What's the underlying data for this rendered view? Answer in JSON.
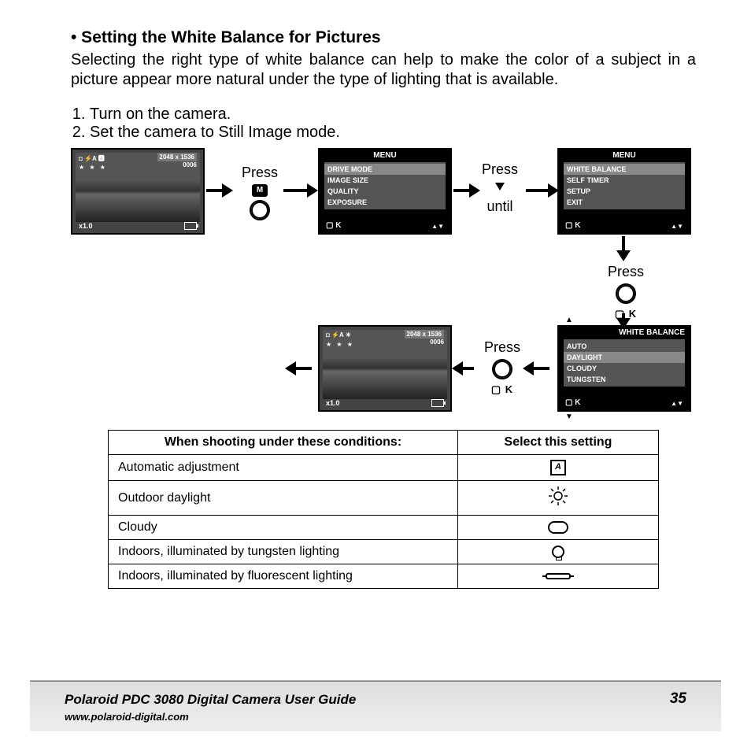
{
  "section_title": "• Setting the White Balance for Pictures",
  "intro": "Selecting the right type of white balance can help to make the color of a subject in a picture appear more natural under the type of lighting that is available.",
  "steps": [
    "Turn on the camera.",
    "Set the camera to Still Image mode."
  ],
  "lcd_preview": {
    "resolution": "2048 x 1536",
    "counter": "0006",
    "stars": "★ ★ ★",
    "zoom": "x1.0"
  },
  "press_label": "Press",
  "until_label": "until",
  "m_label": "M",
  "ok_label": "OK",
  "ok_glyph": "▢ K",
  "nav_glyph": "▲▼",
  "menu1": {
    "title": "MENU",
    "items": [
      "DRIVE MODE",
      "IMAGE SIZE",
      "QUALITY",
      "EXPOSURE"
    ],
    "selected": 0
  },
  "menu2": {
    "title": "MENU",
    "items": [
      "WHITE BALANCE",
      "SELF TIMER",
      "SETUP",
      "EXIT"
    ],
    "selected": 0
  },
  "menu3": {
    "title": "WHITE BALANCE",
    "items": [
      "AUTO",
      "DAYLIGHT",
      "CLOUDY",
      "TUNGSTEN"
    ],
    "selected": 1
  },
  "table": {
    "head_cond": "When shooting under these conditions:",
    "head_sel": "Select this setting",
    "rows": [
      {
        "cond": "Automatic adjustment",
        "icon": "auto"
      },
      {
        "cond": "Outdoor daylight",
        "icon": "sun"
      },
      {
        "cond": "Cloudy",
        "icon": "cloud"
      },
      {
        "cond": "Indoors, illuminated by tungsten lighting",
        "icon": "bulb"
      },
      {
        "cond": "Indoors, illuminated by fluorescent lighting",
        "icon": "fluor"
      }
    ]
  },
  "footer": {
    "title": "Polaroid PDC 3080 Digital Camera User Guide",
    "url": "www.polaroid-digital.com",
    "page": "35"
  }
}
